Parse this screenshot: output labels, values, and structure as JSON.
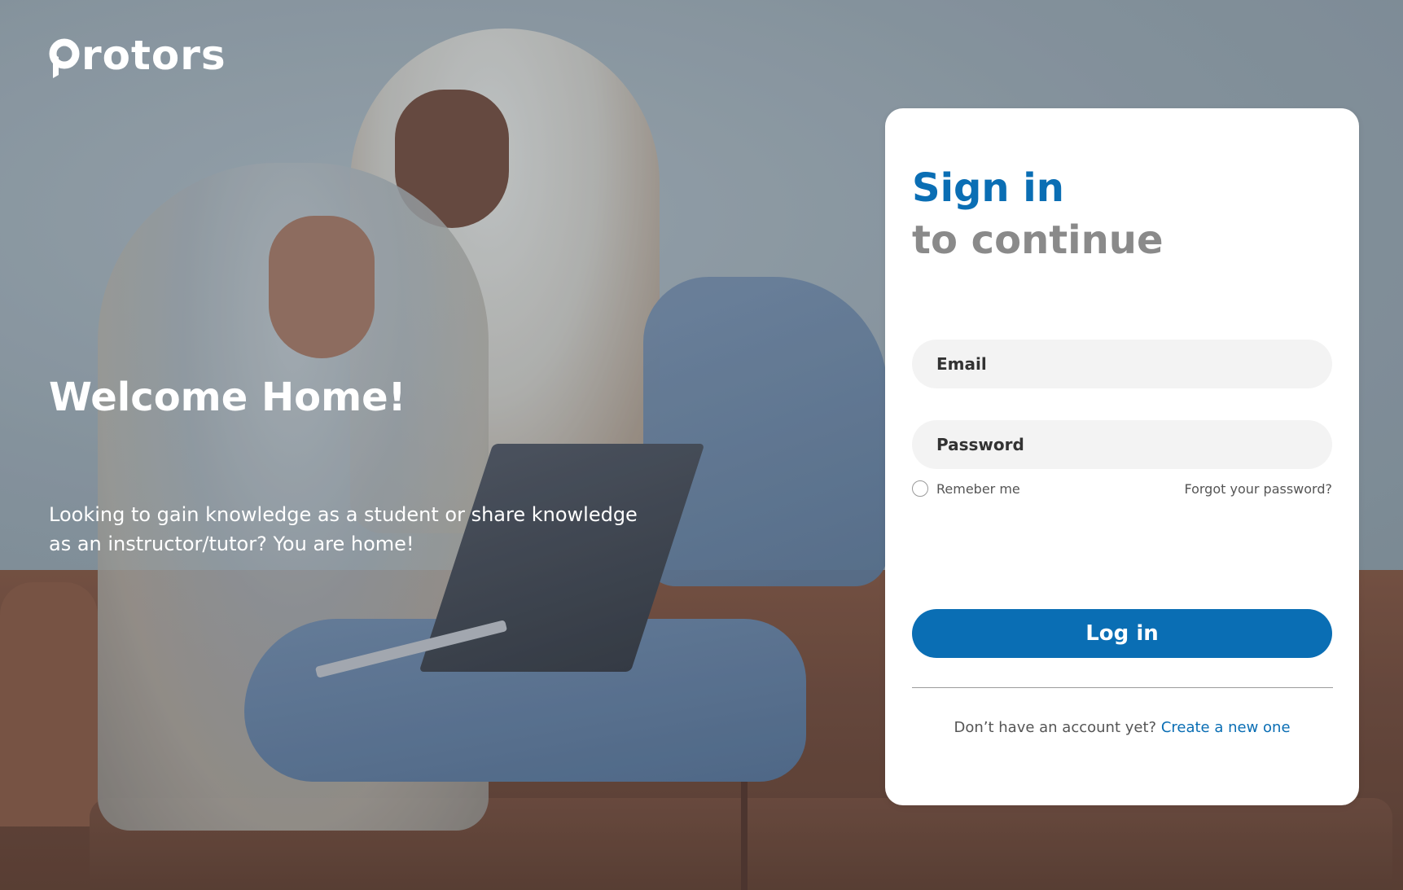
{
  "brand": {
    "logo_text": "rotors"
  },
  "hero": {
    "title": "Welcome Home!",
    "description": "Looking to gain knowledge as a student or share knowledge as an instructor/tutor?  You are home!"
  },
  "signin": {
    "title": "Sign in",
    "subtitle": "to continue",
    "email_placeholder": "Email",
    "password_placeholder": "Password",
    "remember_label": "Remeber me",
    "forgot_label": "Forgot your password?",
    "login_label": "Log in",
    "signup_prompt": "Don’t have an account yet?",
    "signup_link": "Create a new one"
  },
  "colors": {
    "primary": "#0a6eb4",
    "subtitle_gray": "#8a8a8a",
    "field_bg": "#f3f3f3"
  },
  "icons": {
    "logo": "protors-logo-mark"
  }
}
